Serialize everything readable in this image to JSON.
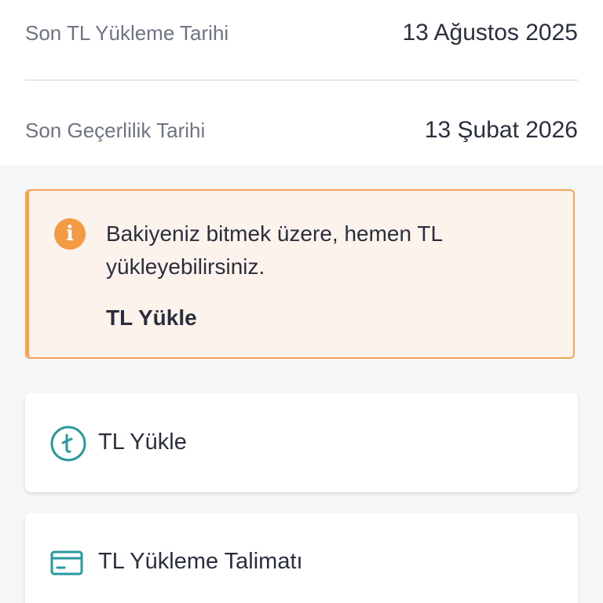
{
  "info": {
    "last_load_label": "Son TL Yükleme Tarihi",
    "last_load_value": "13 Ağustos 2025",
    "expiry_label": "Son Geçerlilik Tarihi",
    "expiry_value": "13 Şubat 2026"
  },
  "alert": {
    "icon": "info-icon",
    "icon_glyph": "i",
    "message": "Bakiyeniz bitmek üzere, hemen TL yükleyebilirsiniz.",
    "action_label": "TL Yükle",
    "accent_color": "#f3a35a",
    "background_color": "#fdf3ed"
  },
  "actions": [
    {
      "label": "TL Yükle",
      "icon": "lira-coin-icon"
    },
    {
      "label": "TL Yükleme Talimatı",
      "icon": "card-icon"
    }
  ],
  "colors": {
    "icon_teal": "#2a9a9e",
    "text_dark": "#2a2f3d",
    "text_muted": "#6e7482"
  }
}
